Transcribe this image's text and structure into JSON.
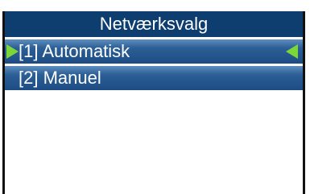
{
  "title": "Netværksvalg",
  "menu": {
    "items": [
      {
        "label": "[1] Automatisk",
        "selected": true
      },
      {
        "label": "[2] Manuel",
        "selected": false
      }
    ]
  },
  "colors": {
    "title_bar": "#0e3e70",
    "item_bar": "#2c5f96",
    "selection_arrow": "#7bd63a",
    "text": "#ffffff"
  },
  "icons": {
    "selection_left": "arrow-right-icon",
    "selection_right": "arrow-left-icon"
  }
}
